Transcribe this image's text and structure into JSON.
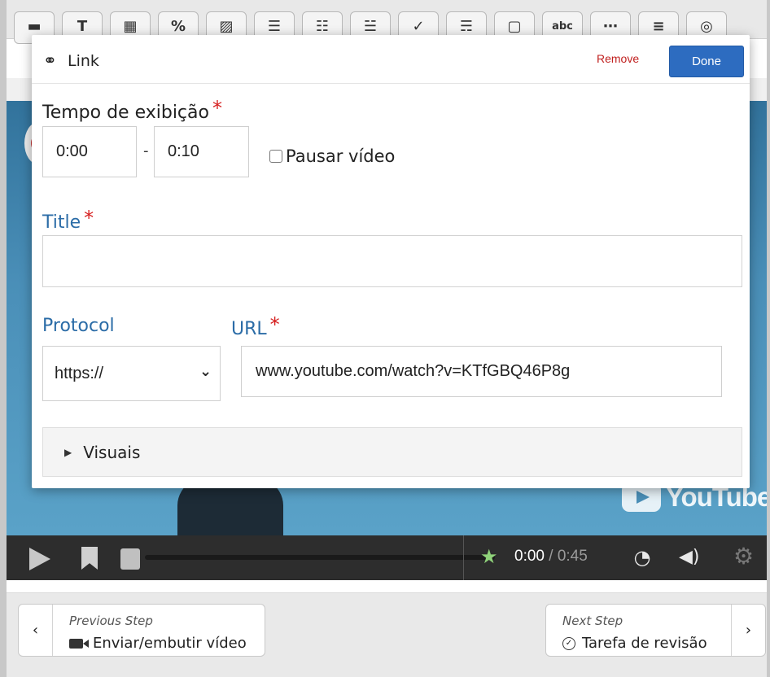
{
  "toolbar": {
    "buttons": [
      {
        "icon": "text-block-icon",
        "glyph": "▬"
      },
      {
        "icon": "text-icon",
        "glyph": "T"
      },
      {
        "icon": "table-icon",
        "glyph": "▦"
      },
      {
        "icon": "link-icon",
        "glyph": "%"
      },
      {
        "icon": "image-icon",
        "glyph": "▨"
      },
      {
        "icon": "list-icon",
        "glyph": "☰"
      },
      {
        "icon": "bullet-list-icon",
        "glyph": "☷"
      },
      {
        "icon": "checklist-icon",
        "glyph": "☱"
      },
      {
        "icon": "check-icon",
        "glyph": "✓"
      },
      {
        "icon": "form-icon",
        "glyph": "☴"
      },
      {
        "icon": "crop-icon",
        "glyph": "▢"
      },
      {
        "icon": "abc-icon",
        "glyph": "abc"
      },
      {
        "icon": "fill-blank-icon",
        "glyph": "⋯"
      },
      {
        "icon": "slider-icon",
        "glyph": "≡"
      },
      {
        "icon": "hotspot-icon",
        "glyph": "◎"
      }
    ]
  },
  "player": {
    "time_current": "0:00",
    "time_total": "/ 0:45",
    "watermark": "YouTube"
  },
  "dialog": {
    "title": "Link",
    "remove_label": "Remove",
    "done_label": "Done",
    "display_time_label": "Tempo de exibição",
    "start_time": "0:00",
    "time_separator": "-",
    "end_time": "0:10",
    "pause_label": "Pausar vídeo",
    "title_label": "Title",
    "title_value": "",
    "protocol_label": "Protocol",
    "protocol_value": "https://",
    "url_label": "URL",
    "url_value": "www.youtube.com/watch?v=KTfGBQ46P8g",
    "visuals_label": "Visuais",
    "required_mark": "*"
  },
  "nav": {
    "prev_kicker": "Previous Step",
    "prev_title": "Enviar/embutir vídeo",
    "next_kicker": "Next Step",
    "next_title": "Tarefa de revisão"
  }
}
